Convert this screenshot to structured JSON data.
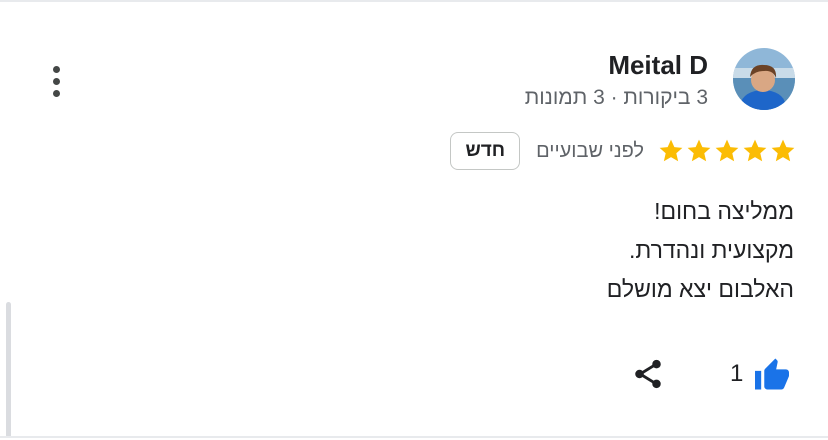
{
  "review": {
    "reviewer_name": "Meital D",
    "reviewer_meta": "3 ביקורות · 3 תמונות",
    "rating": 5,
    "time": "לפני שבועיים",
    "badge": "חדש",
    "text_lines": [
      "ממליצה בחום!",
      "מקצועית ונהדרת.",
      "האלבום יצא מושלם"
    ],
    "likes": "1"
  },
  "icons": {
    "more": "more-vertical-icon",
    "like": "thumb-up-icon",
    "share": "share-icon",
    "star": "star-icon"
  },
  "colors": {
    "star": "#fbbc04",
    "like": "#1a73e8",
    "meta_text": "#5f6368"
  }
}
